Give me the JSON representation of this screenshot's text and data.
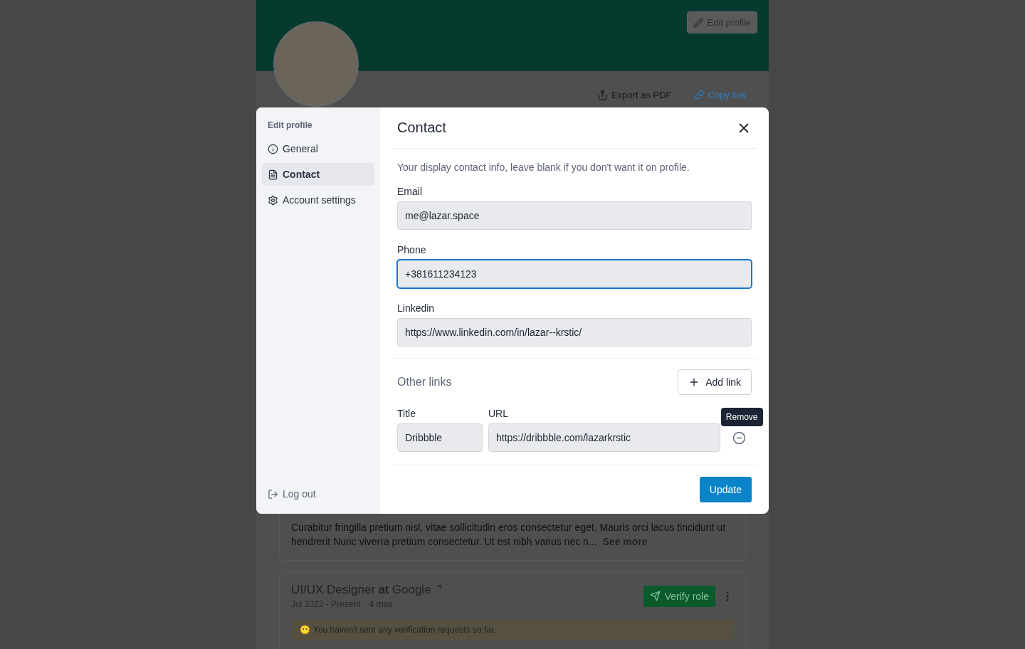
{
  "background": {
    "edit_button": "Edit profile",
    "actions": [
      {
        "label": "Export as PDF",
        "kind": "export"
      },
      {
        "label": "Copy link",
        "kind": "link"
      }
    ],
    "about_text": "Curabitur fringilla pretium nisl, vitae sollicitudin eros consectetur eget. Mauris orci lacus tincidunt ut hendrerit  Nunc viverra pretium consectetur. Ut est nibh varius nec n...",
    "see_more": "See more",
    "experience": {
      "role": "UI/UX Designer",
      "at": "at",
      "company": "Google",
      "dates": "Jul 2022 - Present",
      "separator": "·",
      "duration": "4 mos",
      "verify_button": "Verify role",
      "notice_emoji": "😶",
      "notice": "You haven't sent any verification requests so far."
    }
  },
  "modal": {
    "sidebar": {
      "heading": "Edit profile",
      "items": [
        {
          "label": "General",
          "kind": "info",
          "selected": false
        },
        {
          "label": "Contact",
          "kind": "file",
          "selected": true
        },
        {
          "label": "Account settings",
          "kind": "gear",
          "selected": false
        }
      ],
      "logout": "Log out"
    },
    "title": "Contact",
    "description": "Your display contact info, leave blank if you don't want it on profile.",
    "fields": [
      {
        "label": "Email",
        "value": "me@lazar.space",
        "focused": false
      },
      {
        "label": "Phone",
        "value": "+381611234123 ",
        "focused": true
      },
      {
        "label": "Linkedin",
        "value": "https://www.linkedin.com/in/lazar--krstic/",
        "focused": false
      }
    ],
    "other_links": {
      "title": "Other links",
      "add_button": "Add link",
      "columns": [
        "Title",
        "URL"
      ],
      "rows": [
        {
          "title": "Dribbble",
          "url": "https://dribbble.com/lazarkrstic"
        }
      ],
      "tooltip": "Remove"
    },
    "submit": "Update"
  }
}
